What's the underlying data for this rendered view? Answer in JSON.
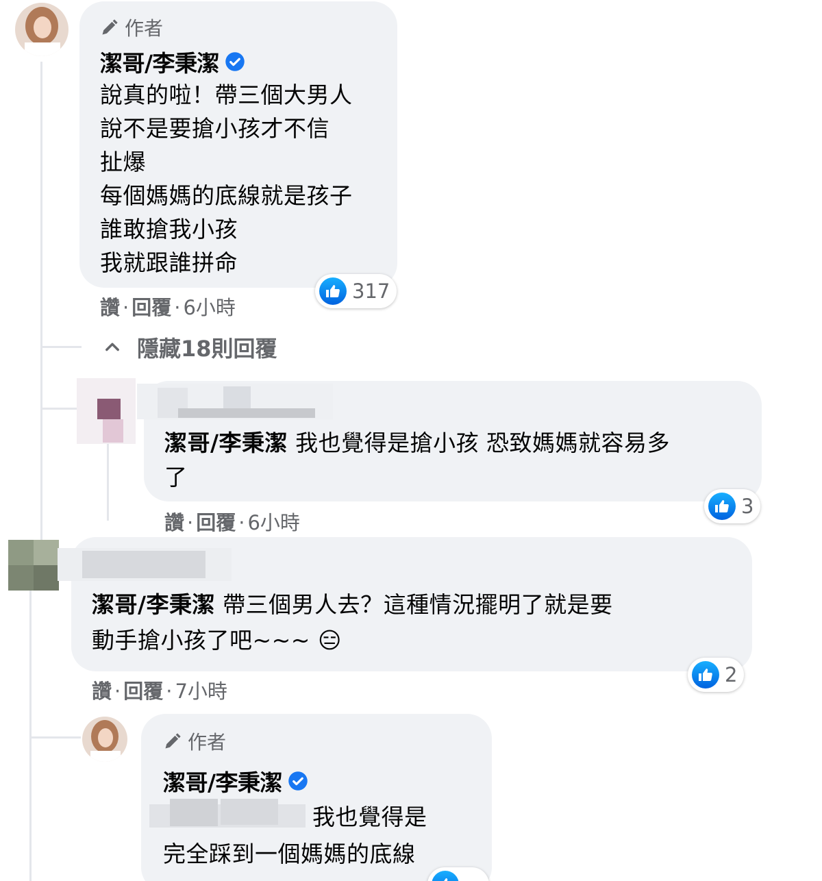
{
  "comments": [
    {
      "author_badge": "作者",
      "author": "潔哥/李秉潔",
      "verified": true,
      "lines": [
        "說真的啦！帶三個大男人",
        "說不是要搶小孩才不信",
        "扯爆",
        "每個媽媽的底線就是孩子",
        "誰敢搶我小孩",
        "我就跟誰拼命"
      ],
      "like_label": "讚",
      "reply_label": "回覆",
      "time": "6小時",
      "reaction_count": "317"
    },
    {
      "hide_replies_label": "隱藏18則回覆"
    },
    {
      "mention": "潔哥/李秉潔",
      "lines": [
        "我也覺得是搶小孩 恐致媽媽就容易多",
        "了"
      ],
      "like_label": "讚",
      "reply_label": "回覆",
      "time": "6小時",
      "reaction_count": "3"
    },
    {
      "mention": "潔哥/李秉潔",
      "lines": [
        "帶三個男人去？這種情況擺明了就是要",
        "動手搶小孩了吧~~~"
      ],
      "emoji": "😑",
      "like_label": "讚",
      "reply_label": "回覆",
      "time": "7小時",
      "reaction_count": "2"
    },
    {
      "author_badge": "作者",
      "author": "潔哥/李秉潔",
      "verified": true,
      "lines": [
        "我也覺得是",
        "完全踩到一個媽媽的底線"
      ]
    }
  ],
  "colors": {
    "bubble": "#f0f2f5",
    "secondary_text": "#65676b",
    "like_blue": "#1877f2",
    "thread_line": "#e4e6eb"
  },
  "icons": [
    "pencil-icon",
    "verified-badge-icon",
    "like-icon",
    "chevron-up-icon",
    "neutral-face-emoji"
  ]
}
